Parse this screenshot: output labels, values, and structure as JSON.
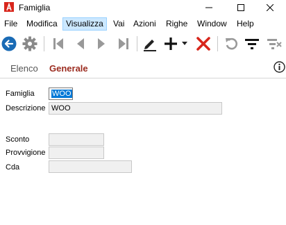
{
  "window": {
    "title": "Famiglia"
  },
  "menu": [
    "File",
    "Modifica",
    "Visualizza",
    "Vai",
    "Azioni",
    "Righe",
    "Window",
    "Help"
  ],
  "menu_active": "Visualizza",
  "toolbar": {
    "buttons": [
      "back-circle-icon",
      "gear-icon",
      "first-record-icon",
      "previous-record-icon",
      "next-record-icon",
      "last-record-icon",
      "edit-pencil-icon",
      "add-plus-icon",
      "dropdown-arrow-icon",
      "delete-x-icon",
      "refresh-icon",
      "filter-icon",
      "clear-filter-icon"
    ]
  },
  "tabs": {
    "elenco": "Elenco",
    "generale": "Generale"
  },
  "form": {
    "famiglia": {
      "label": "Famiglia",
      "value": "WOO"
    },
    "descrizione": {
      "label": "Descrizione",
      "value": "WOO"
    },
    "sconto": {
      "label": "Sconto",
      "value": ""
    },
    "provvigione": {
      "label": "Provvigione",
      "value": ""
    },
    "cda": {
      "label": "Cda",
      "value": ""
    }
  },
  "colors": {
    "accent": "#1a6bb5",
    "tab_active": "#9b2b1f",
    "delete": "#d8261c",
    "selection": "#0078d7"
  }
}
